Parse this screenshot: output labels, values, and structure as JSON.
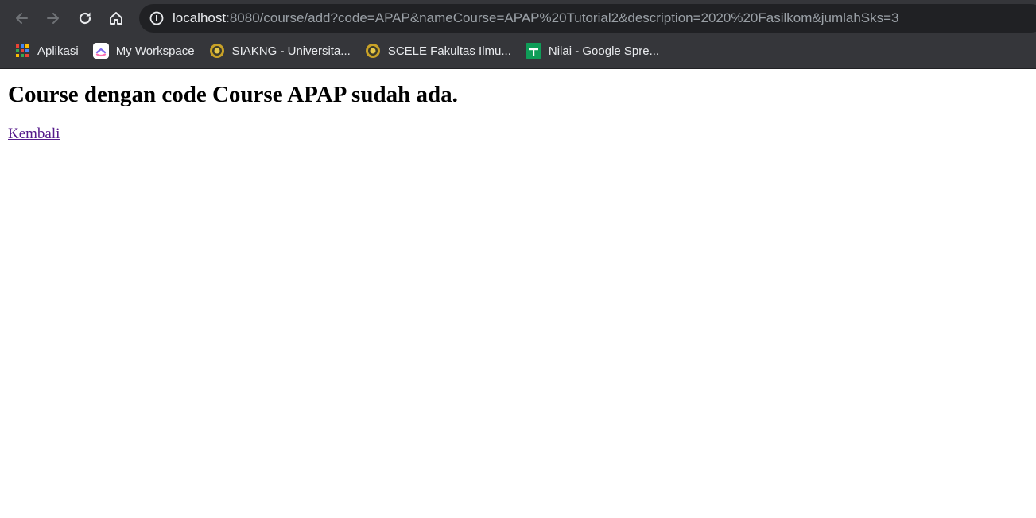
{
  "browser": {
    "url_host": "localhost",
    "url_rest": ":8080/course/add?code=APAP&nameCourse=APAP%20Tutorial2&description=2020%20Fasilkom&jumlahSks=3",
    "bookmarks": [
      {
        "label": "Aplikasi",
        "icon": "apps-grid-icon"
      },
      {
        "label": "My Workspace",
        "icon": "clickup-icon"
      },
      {
        "label": "SIAKNG - Universita...",
        "icon": "ui-seal-icon"
      },
      {
        "label": "SCELE Fakultas Ilmu...",
        "icon": "ui-seal-icon"
      },
      {
        "label": "Nilai - Google Spre...",
        "icon": "google-sheets-icon"
      }
    ]
  },
  "page": {
    "heading": "Course dengan code Course APAP sudah ada.",
    "back_link": "Kembali"
  },
  "colors": {
    "chrome_bg": "#35363a",
    "omnibox_bg": "#202124",
    "link_visited": "#551a8b"
  }
}
